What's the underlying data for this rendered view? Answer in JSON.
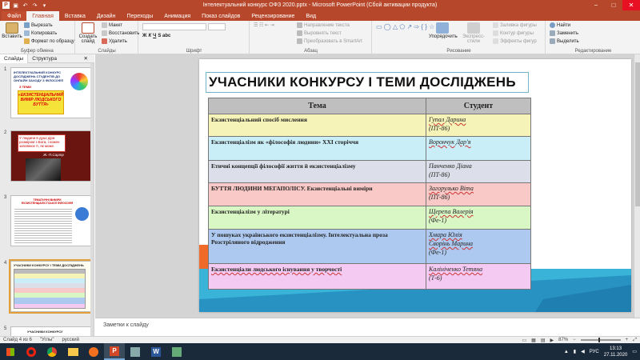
{
  "window": {
    "title": "Інтелектуальний конкурс ОФЗ 2020.pptx - Microsoft PowerPoint (Сбой активации продукта)",
    "controls": [
      "−",
      "□",
      "✕"
    ]
  },
  "tabs": [
    "Файл",
    "Главная",
    "Вставка",
    "Дизайн",
    "Переходы",
    "Анимация",
    "Показ слайдов",
    "Рецензирование",
    "Вид"
  ],
  "ribbon": {
    "clipboard": {
      "paste": "Вставить",
      "cut": "Вырезать",
      "copy": "Копировать",
      "format": "Формат по образцу",
      "label": "Буфер обмена"
    },
    "slides": {
      "create": "Создать слайд",
      "layout": "Макет",
      "restore": "Восстановить",
      "delete": "Удалить",
      "label": "Слайды"
    },
    "font": {
      "label": "Шрифт"
    },
    "paragraph": {
      "direction": "Направление текста",
      "align": "Выровнять текст",
      "smartart": "Преобразовать в SmartArt",
      "label": "Абзац"
    },
    "drawing": {
      "arrange": "Упорядочить",
      "styles": "Экспресс-стили",
      "fill": "Заливка фигуры",
      "outline": "Контур фигуры",
      "effects": "Эффекты фигур",
      "label": "Рисование"
    },
    "editing": {
      "find": "Найти",
      "replace": "Заменить",
      "select": "Выделить",
      "label": "Редактирование"
    }
  },
  "leftpane": {
    "tab_slides": "Слайды",
    "tab_structure": "Структура",
    "thumbs": [
      {
        "num": "1",
        "title_lines": [
          "ІНТЕЛЕКТУАЛЬНИЙ КОНКУРС",
          "ДОСЛІДЖЕНЬ СТУДЕНТІВ ДО",
          "ОНЛАЙН ЗАХОДУ З ФІЛОСОФІЇ"
        ],
        "subtitle": "З ТЕМИ",
        "highlight": "«ЕКЗИСТЕНЦІАЛЬНИЙ ВИМІР ЛЮДСЬКОГО БУТТЯ»"
      },
      {
        "num": "2",
        "quote": "У людини в душі діра розміром з Бога, і кожен заповнює її, як може.",
        "author": "Ж.-П.Сартр"
      },
      {
        "num": "3",
        "title": "ТЕМАТИЧНІ ВИМІРИ ЕКЗИСТЕНЦІАЛІСТСЬКОЇ ФІЛОСОФІЇ"
      },
      {
        "num": "4"
      },
      {
        "num": "5",
        "title": "УЧАСНИКИ КОНКУРСУ"
      }
    ]
  },
  "slide": {
    "title": "УЧАСНИКИ КОНКУРСУ І ТЕМИ ДОСЛІДЖЕНЬ",
    "headers": {
      "topic": "Тема",
      "student": "Студент"
    },
    "rows": [
      {
        "topic": "Екзистенціальний спосіб мислення",
        "student": [
          "Гупал Дарина",
          "(ПТ-86)"
        ]
      },
      {
        "topic": "Екзистенціалізм як «філософія людини» XXI сторіччя",
        "student": [
          "Ворончук Дар'я"
        ]
      },
      {
        "topic": "Етичні концепції філософії життя й екзистенціалізму",
        "student": [
          "Панченко Діана",
          "(ПТ-86)"
        ]
      },
      {
        "topic": "БУТТЯ ЛЮДИНИ МЕГАПОЛІСУ. Екзистенціальні виміри",
        "student": [
          "Загорулько Віта",
          "(ПТ-86)"
        ]
      },
      {
        "topic": "Екзистенціалізм у літературі",
        "student": [
          "Щерепа Валерія",
          "(Фе-1)"
        ]
      },
      {
        "topic": "У пошуках українського екзистенціалізму. Інтелектуальна проза Розстріляного відродження",
        "student": [
          "Хмара Юлія",
          "Сворінь Марина",
          "(Фе-1)"
        ]
      },
      {
        "topic": "Екзистенціали людського існування у творчості",
        "student": [
          "Калініченко Тетяна",
          "(Т-6)"
        ]
      }
    ],
    "row_colors": [
      "#f5f3b8",
      "#c9eef8",
      "#dcdfe9",
      "#f8c9c6",
      "#d9f7c4",
      "#aec9ef",
      "#f5caf2"
    ]
  },
  "notes": {
    "placeholder": "Заметки к слайду"
  },
  "status": {
    "slide": "Слайд 4 из 6",
    "theme": "\"Углы\"",
    "lang": "русский",
    "zoom": "87%"
  },
  "taskbar": {
    "lang": "РУС",
    "time": "13:13",
    "date": "27.11.2020"
  }
}
